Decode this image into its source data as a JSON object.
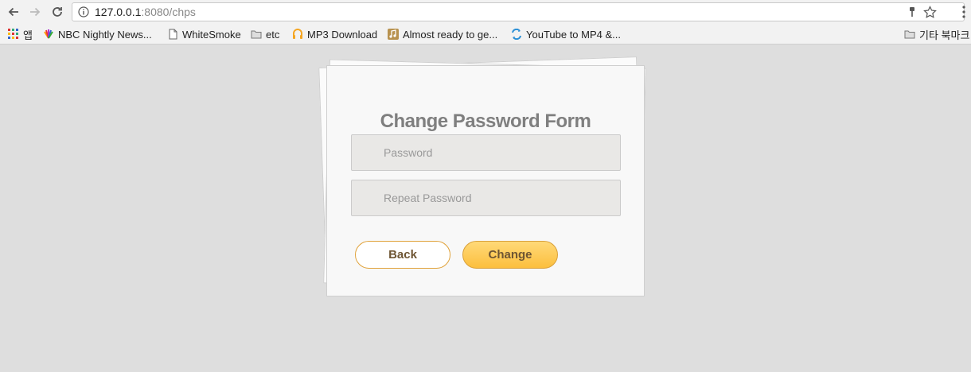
{
  "browser": {
    "url_host": "127.0.0.1",
    "url_path": ":8080/chps"
  },
  "bookmarks": [
    {
      "label": "앱",
      "icon": "apps-grid-icon"
    },
    {
      "label": "NBC Nightly News...",
      "icon": "nbc-peacock-icon"
    },
    {
      "label": "WhiteSmoke",
      "icon": "page-icon"
    },
    {
      "label": "etc",
      "icon": "folder-icon"
    },
    {
      "label": "MP3 Download",
      "icon": "mp3-icon"
    },
    {
      "label": "Almost ready to ge...",
      "icon": "music-icon"
    },
    {
      "label": "YouTube to MP4 &...",
      "icon": "convert-icon"
    }
  ],
  "other_bookmarks": {
    "label": "기타 북마크",
    "icon": "folder-icon"
  },
  "form": {
    "title": "Change Password Form",
    "password_placeholder": "Password",
    "repeat_password_placeholder": "Repeat Password",
    "back_label": "Back",
    "change_label": "Change"
  },
  "colors": {
    "accent": "#fcbf3e",
    "button_border": "#e0a23a",
    "title": "#7f7f7f",
    "background": "#dedede"
  }
}
